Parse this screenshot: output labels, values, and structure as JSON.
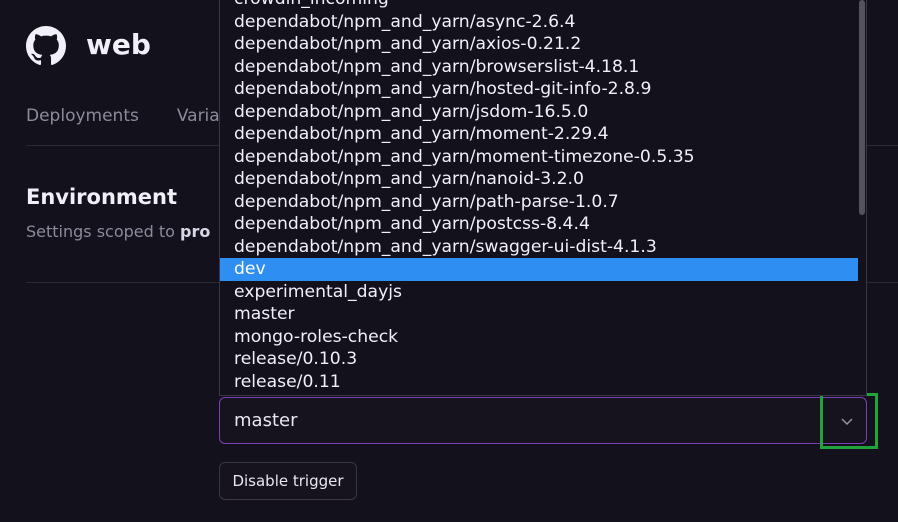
{
  "header": {
    "service_name": "web",
    "logo_icon": "github-icon"
  },
  "tabs": [
    "Deployments",
    "Varial"
  ],
  "environment": {
    "title": "Environment",
    "subtitle_prefix": "Settings scoped to ",
    "subtitle_strong": "pro"
  },
  "branch_select": {
    "value": "master",
    "options": [
      "crowdin_incoming",
      "dependabot/npm_and_yarn/async-2.6.4",
      "dependabot/npm_and_yarn/axios-0.21.2",
      "dependabot/npm_and_yarn/browserslist-4.18.1",
      "dependabot/npm_and_yarn/hosted-git-info-2.8.9",
      "dependabot/npm_and_yarn/jsdom-16.5.0",
      "dependabot/npm_and_yarn/moment-2.29.4",
      "dependabot/npm_and_yarn/moment-timezone-0.5.35",
      "dependabot/npm_and_yarn/nanoid-3.2.0",
      "dependabot/npm_and_yarn/path-parse-1.0.7",
      "dependabot/npm_and_yarn/postcss-8.4.4",
      "dependabot/npm_and_yarn/swagger-ui-dist-4.1.3",
      "dev",
      "experimental_dayjs",
      "master",
      "mongo-roles-check",
      "release/0.10.3",
      "release/0.11"
    ],
    "highlighted_option": "dev",
    "chevron_icon": "chevron-down-icon"
  },
  "disable_trigger_label": "Disable trigger",
  "colors": {
    "background": "#13111c",
    "accent_border": "#7a3fb8",
    "selected_option": "#2f8ef2",
    "highlight_box": "#1fa33a"
  }
}
